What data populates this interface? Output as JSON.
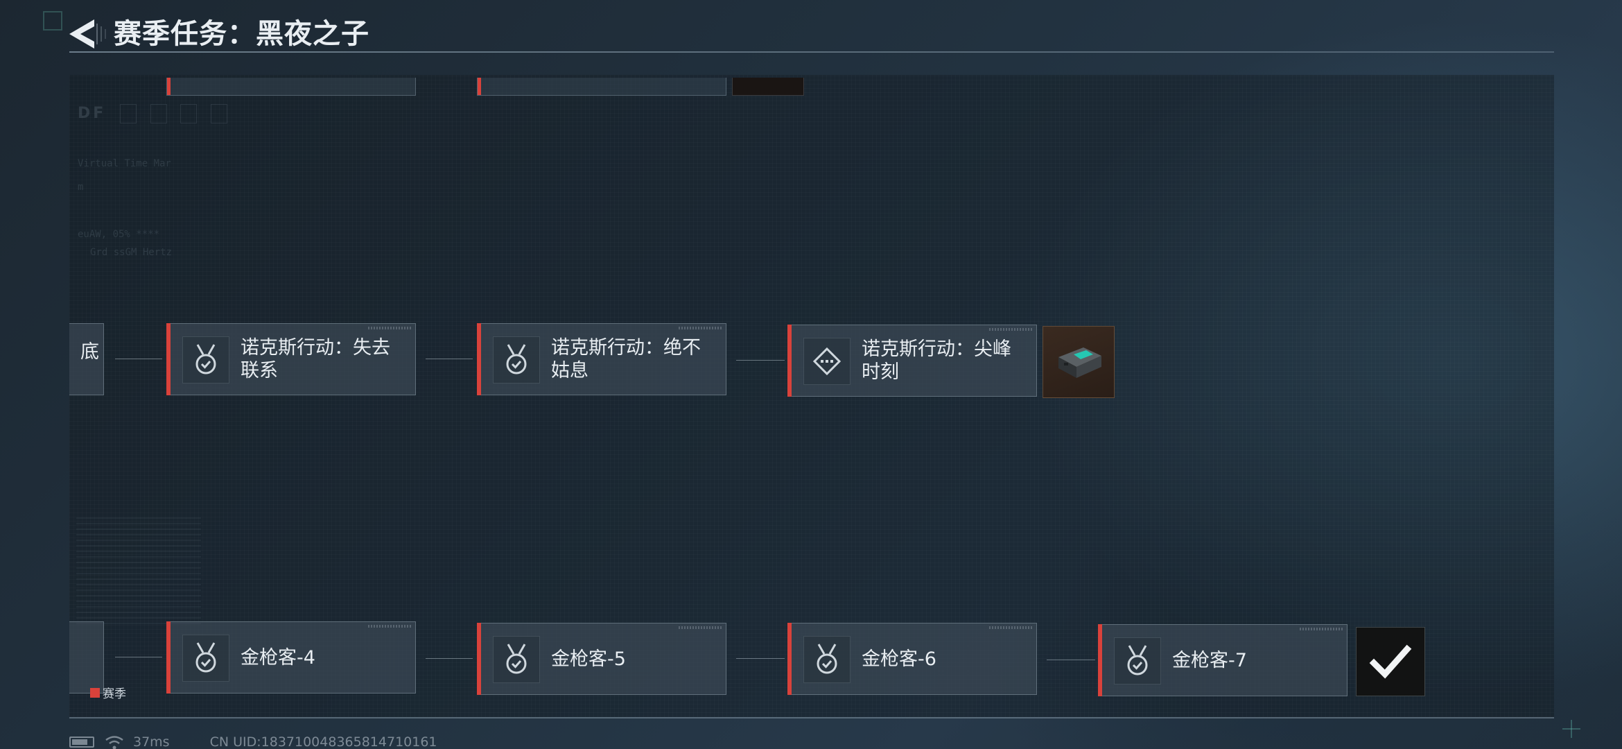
{
  "header": {
    "title": "赛季任务：黑夜之子"
  },
  "background": {
    "df_label": "DF",
    "line1": "Virtual Time Mar",
    "line2": "m",
    "line3": "euAW, 05% ****",
    "line4": "Grd     ssGM Hertz"
  },
  "rows": {
    "upper": {
      "partial_fragment": "底",
      "cards": [
        {
          "label": "诺克斯行动：失去联系",
          "icon": "medal-check"
        },
        {
          "label": "诺克斯行动：绝不姑息",
          "icon": "medal-check"
        },
        {
          "label": "诺克斯行动：尖峰时刻",
          "icon": "diamond-dots"
        }
      ],
      "reward": "item-box"
    },
    "lower": {
      "cards": [
        {
          "label": "金枪客-4",
          "icon": "medal-check"
        },
        {
          "label": "金枪客-5",
          "icon": "medal-check"
        },
        {
          "label": "金枪客-6",
          "icon": "medal-check"
        },
        {
          "label": "金枪客-7",
          "icon": "medal-check"
        }
      ],
      "completed": true
    }
  },
  "legend": {
    "label": "赛季",
    "color": "#d9423b"
  },
  "status_bar": {
    "ping": "37ms",
    "uid": "CN UID:1837100483658147101​61"
  },
  "colors": {
    "accent_red": "#d9423b",
    "card_bg": "#404e5a",
    "text": "#e9eef2"
  }
}
